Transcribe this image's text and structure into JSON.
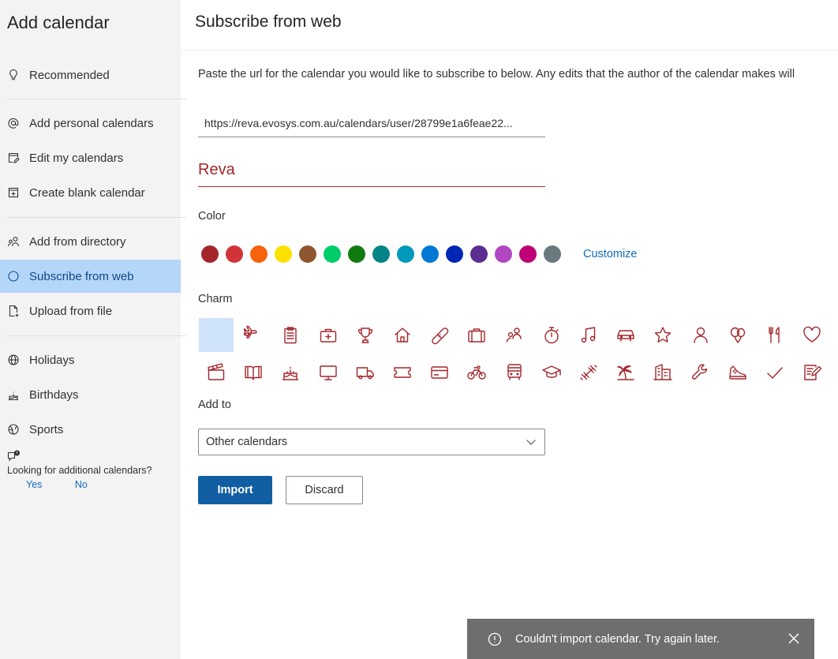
{
  "sidebar": {
    "title": "Add calendar",
    "items": [
      {
        "label": "Recommended",
        "icon": "lightbulb-icon"
      },
      {
        "label": "Add personal calendars",
        "icon": "at-icon"
      },
      {
        "label": "Edit my calendars",
        "icon": "edit-calendar-icon"
      },
      {
        "label": "Create blank calendar",
        "icon": "add-calendar-icon"
      },
      {
        "label": "Add from directory",
        "icon": "people-icon"
      },
      {
        "label": "Subscribe from web",
        "icon": "web-icon"
      },
      {
        "label": "Upload from file",
        "icon": "file-upload-icon"
      },
      {
        "label": "Holidays",
        "icon": "globe-icon"
      },
      {
        "label": "Birthdays",
        "icon": "cake-icon"
      },
      {
        "label": "Sports",
        "icon": "sports-ball-icon"
      }
    ],
    "active_item": "Subscribe from web",
    "feedback": {
      "question": "Looking for additional calendars?",
      "yes": "Yes",
      "no": "No"
    }
  },
  "main": {
    "title": "Subscribe from web",
    "description": "Paste the url for the calendar you would like to subscribe to below. Any edits that the author of the calendar makes will",
    "url_value": "https://reva.evosys.com.au/calendars/user/28799e1a6feae22...",
    "calendar_name": "Reva",
    "color_label": "Color",
    "colors": [
      "#a4262c",
      "#d13438",
      "#f7630c",
      "#fce100",
      "#8e562e",
      "#00cc6a",
      "#107c10",
      "#038387",
      "#0099bc",
      "#0078d4",
      "#0027b4",
      "#5c2e91",
      "#b146c2",
      "#bf0077",
      "#69797e"
    ],
    "customize_label": "Customize",
    "charm_label": "Charm",
    "charms": [
      "none",
      "airplane",
      "clipboard",
      "medical-kit",
      "trophy",
      "home",
      "bandage",
      "briefcase",
      "people",
      "timer",
      "music-note",
      "car",
      "star",
      "person",
      "balloons",
      "fork-knife",
      "heart",
      "clapperboard",
      "book",
      "birthday-cake",
      "monitor",
      "truck",
      "ticket",
      "credit-card",
      "bicycle",
      "bus",
      "graduation-cap",
      "dumbbell",
      "palm-tree",
      "building",
      "wrench",
      "sneaker",
      "checkmark",
      "notepad"
    ],
    "add_to_label": "Add to",
    "add_to_value": "Other calendars",
    "import_label": "Import",
    "discard_label": "Discard"
  },
  "toast": {
    "message": "Couldn't import calendar. Try again later."
  },
  "accent_color": "#a4262c",
  "brand_color": "#115ea3"
}
